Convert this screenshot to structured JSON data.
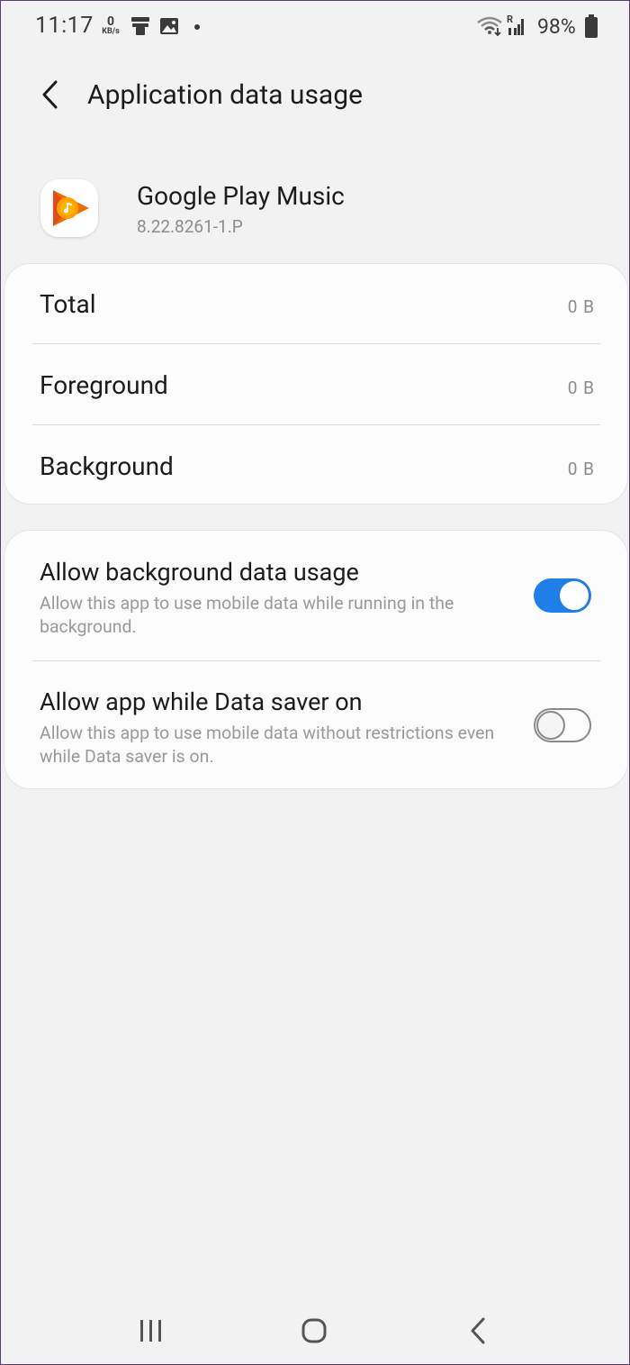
{
  "status_bar": {
    "time": "11:17",
    "net_speed_value": "0",
    "net_speed_unit": "KB/s",
    "battery_percent": "98%",
    "icons": [
      "store-icon",
      "image-icon",
      "dot-icon",
      "wifi-icon",
      "signal-icon",
      "battery-icon"
    ],
    "signal_label": "R"
  },
  "header": {
    "title": "Application data usage",
    "back_icon": "chevron-left-icon"
  },
  "app": {
    "name": "Google Play Music",
    "version": "8.22.8261-1.P",
    "icon": "google-play-music-icon"
  },
  "usage": {
    "rows": [
      {
        "label": "Total",
        "value": "0 B"
      },
      {
        "label": "Foreground",
        "value": "0 B"
      },
      {
        "label": "Background",
        "value": "0 B"
      }
    ]
  },
  "permissions": {
    "items": [
      {
        "title": "Allow background data usage",
        "description": "Allow this app to use mobile data while running in the background.",
        "enabled": true
      },
      {
        "title": "Allow app while Data saver on",
        "description": "Allow this app to use mobile data without restrictions even while Data saver is on.",
        "enabled": false
      }
    ]
  },
  "nav_bar": {
    "buttons": [
      "recents-icon",
      "home-icon",
      "back-icon"
    ]
  },
  "colors": {
    "background": "#f2f2f2",
    "card": "#fcfcfc",
    "accent": "#1f7ee8",
    "primary_text": "#1c1c1c",
    "secondary_text": "#8c8c8c"
  }
}
